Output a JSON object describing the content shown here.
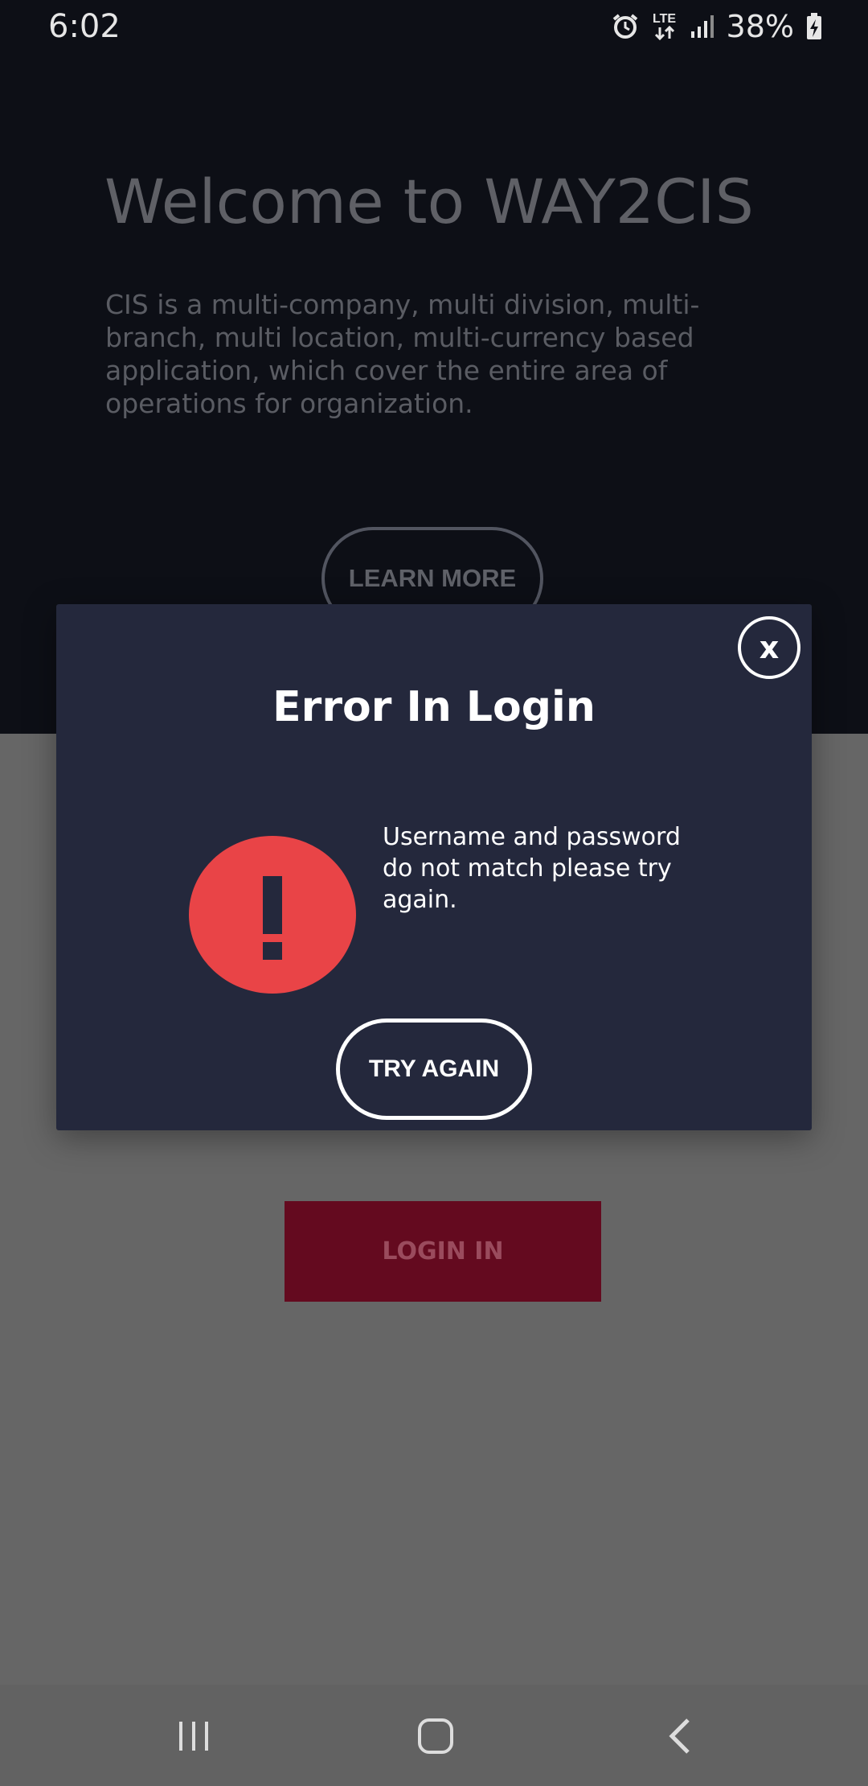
{
  "status_bar": {
    "time": "6:02",
    "network": "LTE",
    "battery": "38%",
    "icons": [
      "alarm-icon",
      "lte-data-icon",
      "signal-icon",
      "battery-charging-icon"
    ]
  },
  "hero": {
    "title": "Welcome to WAY2CIS",
    "description": "CIS is a multi-company, multi division, multi-branch, multi location, multi-currency based application, which cover the entire area of operations for organization.",
    "learn_more_label": "LEARN MORE"
  },
  "login": {
    "button_label": "LOGIN IN"
  },
  "modal": {
    "close_label": "x",
    "title": "Error In Login",
    "message": "Username and password do not match please try again.",
    "try_again_label": "TRY AGAIN",
    "icon": "exclamation-icon"
  },
  "colors": {
    "hero_bg": "#0d0f16",
    "modal_bg": "#24283c",
    "error_red": "#e94447",
    "login_bg": "#640a1f",
    "overlay_gray": "#666666"
  },
  "nav_bar": {
    "items": [
      "recent-apps-icon",
      "home-icon",
      "back-icon"
    ]
  }
}
